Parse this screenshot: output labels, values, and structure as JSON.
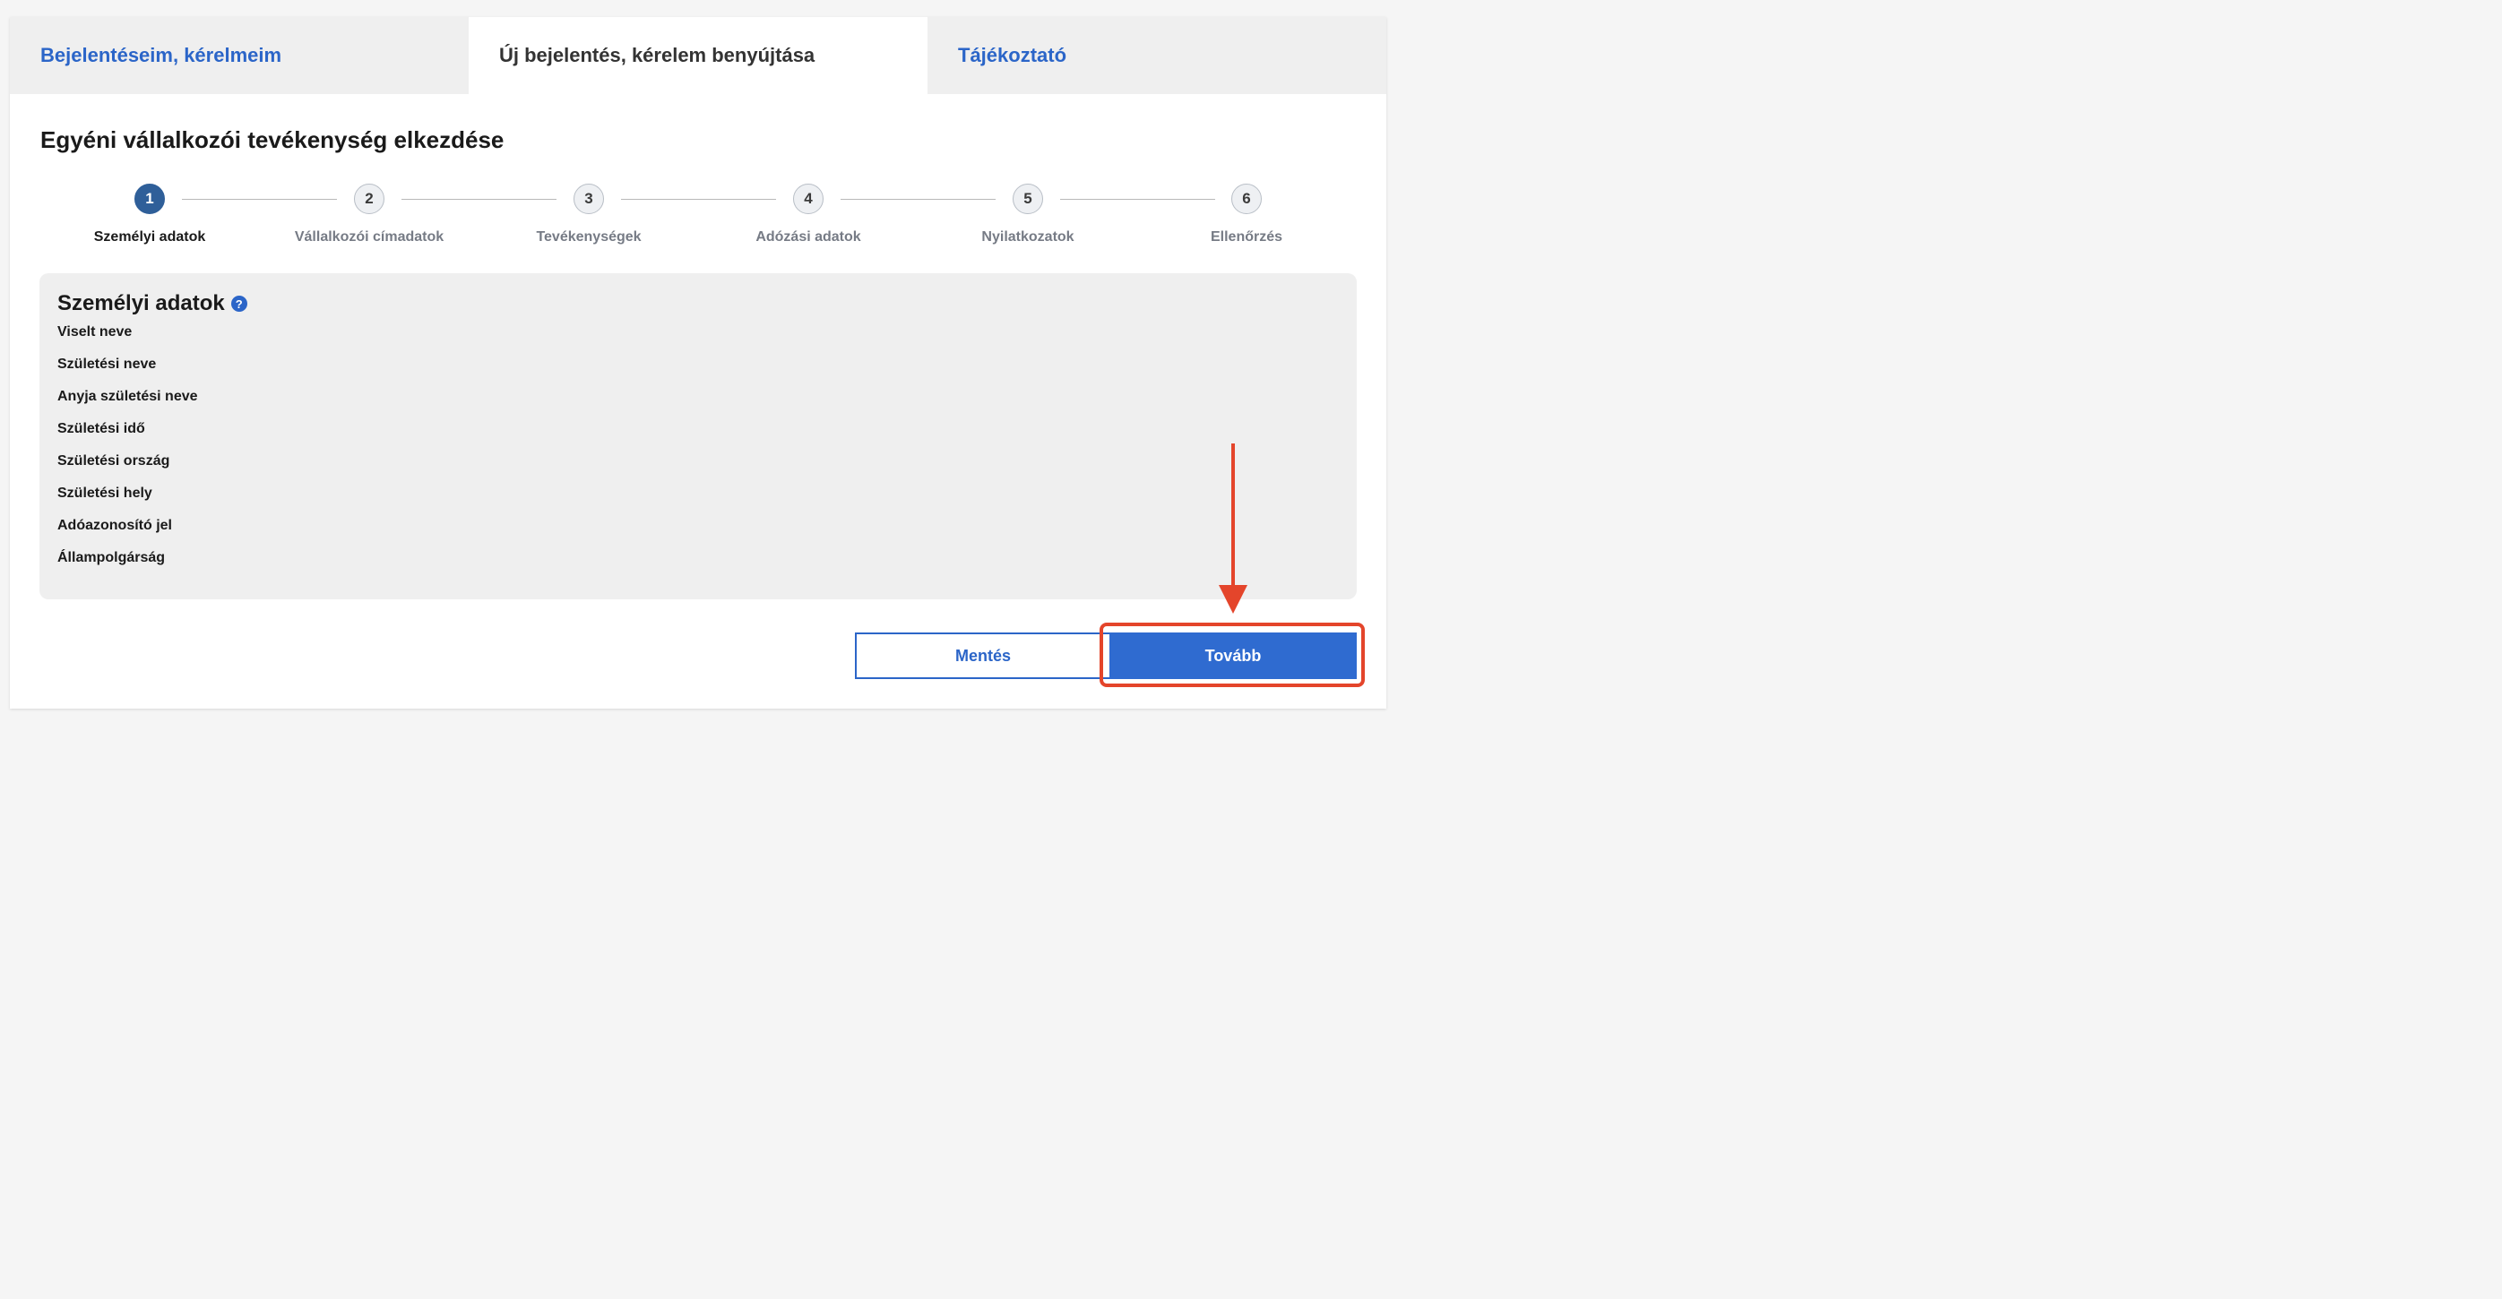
{
  "tabs": [
    {
      "label": "Bejelentéseim, kérelmeim",
      "active": false
    },
    {
      "label": "Új bejelentés, kérelem benyújtása",
      "active": true
    },
    {
      "label": "Tájékoztató",
      "active": false
    }
  ],
  "page_title": "Egyéni vállalkozói tevékenység elkezdése",
  "stepper": {
    "current": 1,
    "steps": [
      {
        "number": "1",
        "label": "Személyi adatok"
      },
      {
        "number": "2",
        "label": "Vállalkozói címadatok"
      },
      {
        "number": "3",
        "label": "Tevékenységek"
      },
      {
        "number": "4",
        "label": "Adózási adatok"
      },
      {
        "number": "5",
        "label": "Nyilatkozatok"
      },
      {
        "number": "6",
        "label": "Ellenőrzés"
      }
    ]
  },
  "panel": {
    "title": "Személyi adatok",
    "help_icon": "question-circle-icon",
    "help_glyph": "?",
    "fields": [
      "Viselt neve",
      "Születési neve",
      "Anyja születési neve",
      "Születési idő",
      "Születési ország",
      "Születési hely",
      "Adóazonosító jel",
      "Állampolgárság"
    ]
  },
  "buttons": {
    "save_label": "Mentés",
    "next_label": "Tovább"
  },
  "colors": {
    "accent": "#2b65c8",
    "step_active": "#2f5f99",
    "annotation": "#e4452b"
  }
}
